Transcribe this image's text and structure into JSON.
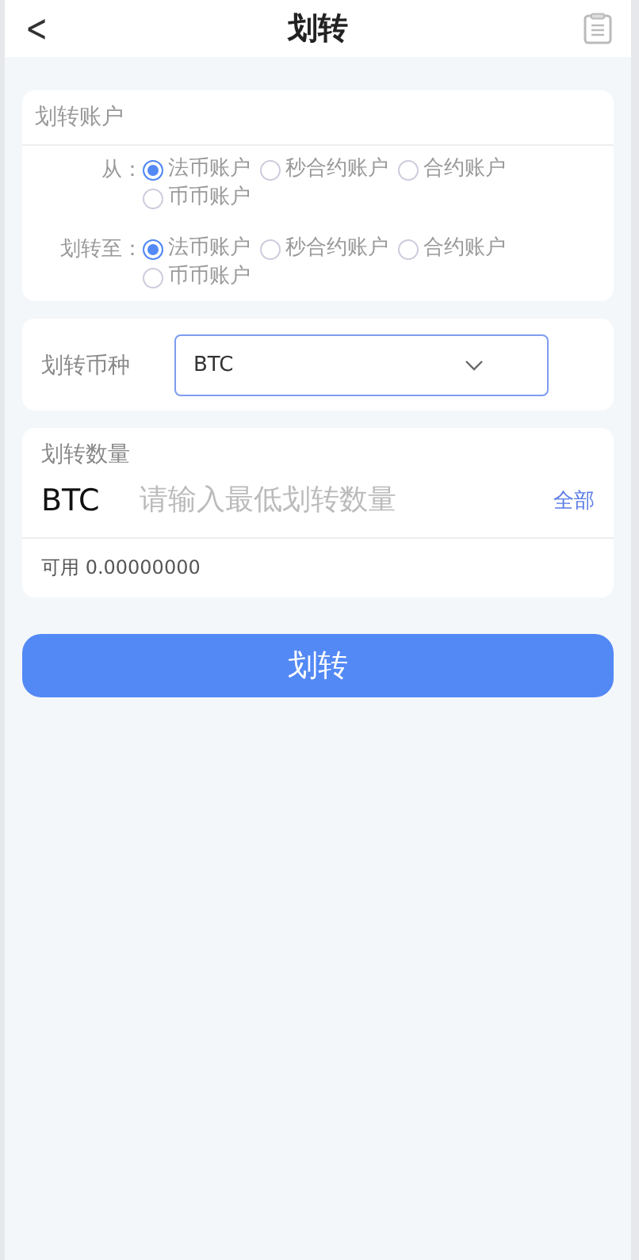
{
  "header": {
    "back": "<",
    "title": "划转"
  },
  "account_card": {
    "title": "划转账户",
    "groups": [
      {
        "label": "从：",
        "options": [
          {
            "label": "法币账户",
            "selected": true
          },
          {
            "label": "秒合约账户",
            "selected": false
          },
          {
            "label": "合约账户",
            "selected": false
          },
          {
            "label": "币币账户",
            "selected": false
          }
        ]
      },
      {
        "label": "划转至：",
        "options": [
          {
            "label": "法币账户",
            "selected": true
          },
          {
            "label": "秒合约账户",
            "selected": false
          },
          {
            "label": "合约账户",
            "selected": false
          },
          {
            "label": "币币账户",
            "selected": false
          }
        ]
      }
    ]
  },
  "coin_card": {
    "label": "划转币种",
    "value": "BTC"
  },
  "amount_card": {
    "title": "划转数量",
    "unit": "BTC",
    "placeholder": "请输入最低划转数量",
    "all": "全部",
    "available": "可用 0.00000000"
  },
  "submit": "划转"
}
